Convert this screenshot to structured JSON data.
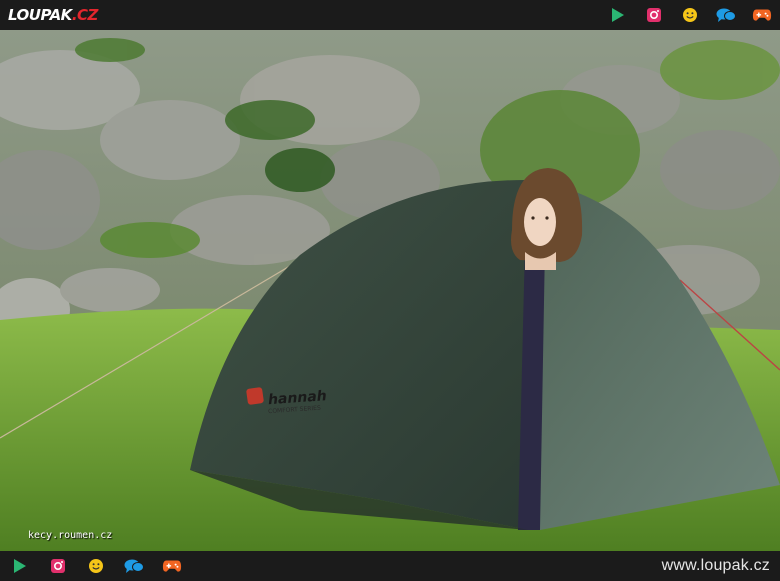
{
  "site": {
    "logo_text": "LOUPAK",
    "logo_tld": ".CZ",
    "url": "www.loupak.cz",
    "watermark": "kecy.roumen.cz"
  },
  "nav_icons": [
    "play-icon",
    "instagram-icon",
    "smiley-icon",
    "chat-bubbles-icon",
    "gamepad-icon"
  ],
  "colors": {
    "bar": "#1b1b1b",
    "play": "#2bb673",
    "instagram": "#e1306c",
    "smiley": "#f5c518",
    "chat": "#1e9be5",
    "gamepad": "#f26522",
    "brand_red": "#e3262d"
  },
  "photo": {
    "tent_brand": "hannah",
    "tent_subline": "COMFORT SERIES"
  }
}
